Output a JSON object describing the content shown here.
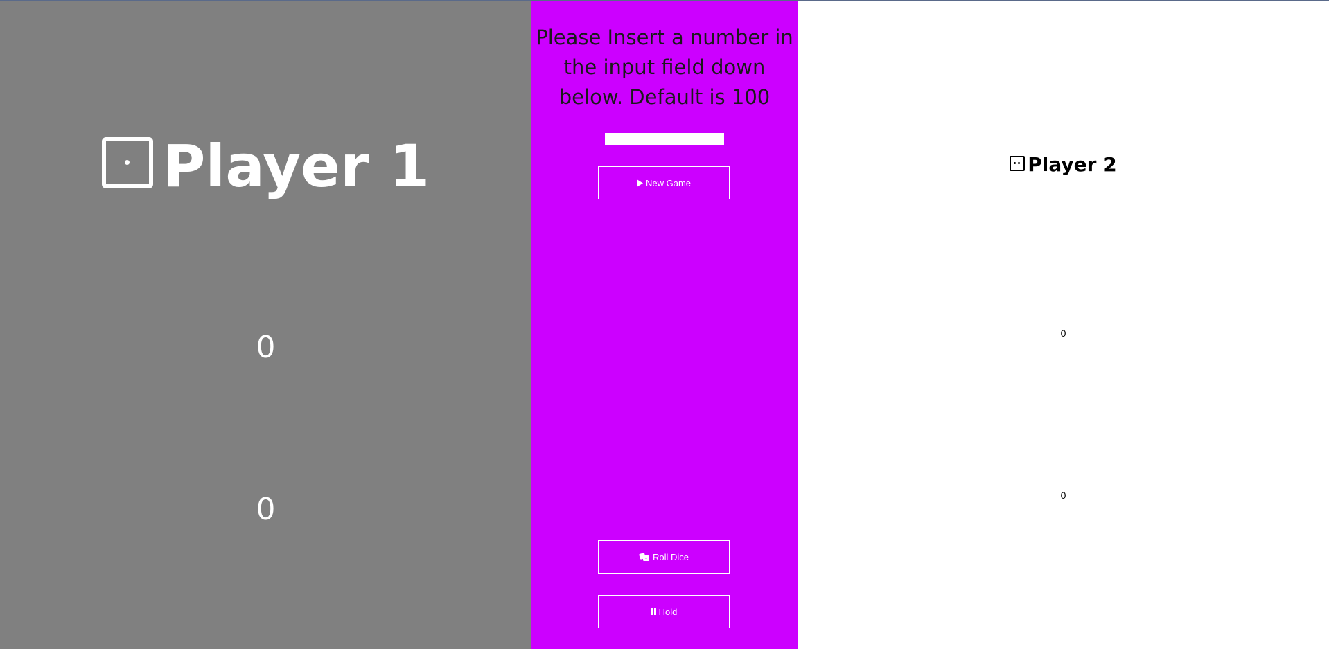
{
  "player1": {
    "name": "Player 1",
    "die_icon": "die-one-icon",
    "total_score": "0",
    "current_score": "0",
    "panel_color": "#808080"
  },
  "controls": {
    "instructions": "Please Insert a number in the input field down below. Default is 100",
    "target_input_value": "",
    "target_input_placeholder": "",
    "new_game_label": "New Game",
    "roll_dice_label": "Roll Dice",
    "hold_label": "Hold",
    "panel_color": "#cc00ff"
  },
  "player2": {
    "name": "Player 2",
    "die_icon": "die-two-icon",
    "total_score": "0",
    "current_score": "0",
    "panel_color": "#ffffff"
  }
}
